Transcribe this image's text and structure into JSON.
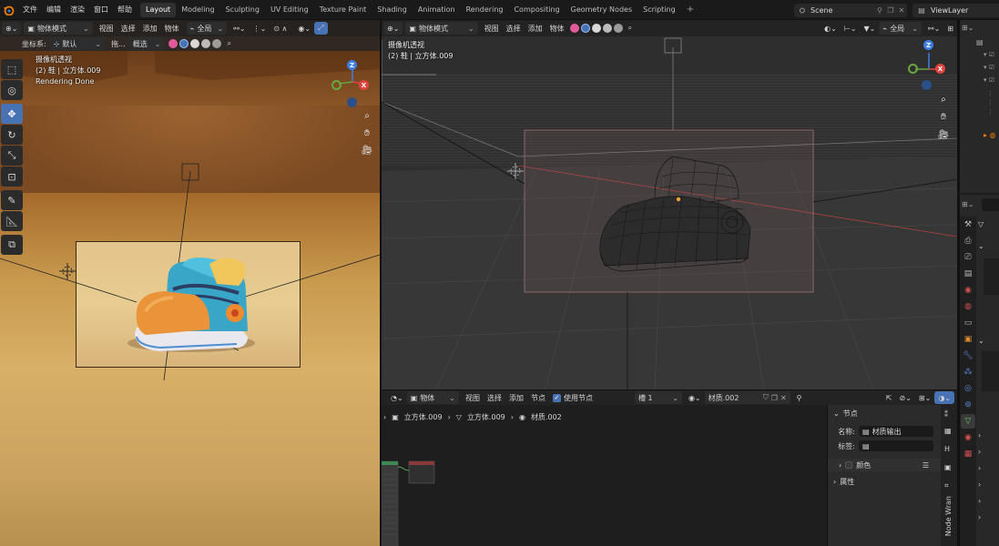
{
  "topbar": {
    "menus": [
      "文件",
      "编辑",
      "渲染",
      "窗口",
      "帮助"
    ],
    "workspaces": [
      "Layout",
      "Modeling",
      "Sculpting",
      "UV Editing",
      "Texture Paint",
      "Shading",
      "Animation",
      "Rendering",
      "Compositing",
      "Geometry Nodes",
      "Scripting"
    ],
    "active_workspace": "Layout",
    "add_symbol": "+",
    "scene": "Scene",
    "view_layer": "ViewLayer"
  },
  "left_viewport": {
    "mode": "物体模式",
    "menus": [
      "视图",
      "选择",
      "添加",
      "物体"
    ],
    "transform_space": "全局",
    "coord_label": "坐标系:",
    "coord_value": "默认",
    "drag_label": "拖...",
    "select_label": "概选",
    "info_title": "摄像机透视",
    "info_object": "(2) 鞋 | 立方体.009",
    "info_status": "Rendering Done"
  },
  "right_viewport": {
    "mode": "物体模式",
    "menus": [
      "视图",
      "选择",
      "添加",
      "物体"
    ],
    "transform_space": "全局",
    "info_title": "摄像机透视",
    "info_object": "(2) 鞋 | 立方体.009"
  },
  "node_editor": {
    "mode": "物体",
    "menus": [
      "视图",
      "选择",
      "添加",
      "节点"
    ],
    "use_nodes_label": "使用节点",
    "slot": "槽 1",
    "material": "材质.002",
    "breadcrumb": [
      "立方体.009",
      "立方体.009",
      "材质.002"
    ],
    "panel": {
      "section_title": "节点",
      "name_label": "名称:",
      "name_value": "材质输出",
      "tag_label": "标签:",
      "color_label": "颜色",
      "props_label": "属性"
    },
    "side_tabs": [
      "Node Wran"
    ]
  },
  "colors": {
    "accent": "#4772b3",
    "x_axis": "#e0443e",
    "y_axis": "#6aa63f",
    "z_axis": "#3e7ee0",
    "origin": "#f0a030"
  }
}
